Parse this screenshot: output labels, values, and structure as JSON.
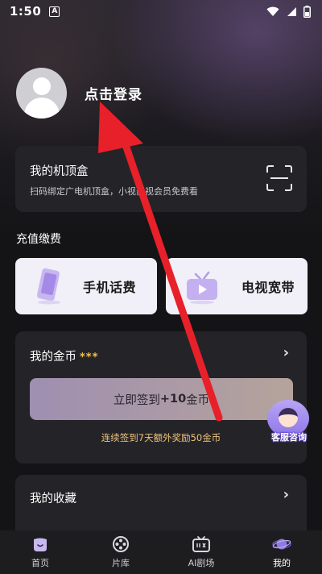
{
  "status_bar": {
    "time": "1:50",
    "notification_letter": "A"
  },
  "profile": {
    "login_text": "点击登录"
  },
  "set_top_box": {
    "title": "我的机顶盒",
    "subtitle": "扫码绑定广电机顶盒，小视影视会员免费看"
  },
  "recharge": {
    "section_title": "充值缴费",
    "phone_label": "手机话费",
    "tv_label": "电视宽带"
  },
  "coins": {
    "title": "我的金币",
    "stars": "***",
    "signin_prefix": "立即签到",
    "signin_bonus": "+10",
    "signin_suffix": "金币",
    "note": "连续签到7天额外奖励50金币"
  },
  "favorites": {
    "title": "我的收藏"
  },
  "customer_service": {
    "label": "客服咨询"
  },
  "tabbar": {
    "items": [
      {
        "label": "首页",
        "icon": "home-icon"
      },
      {
        "label": "片库",
        "icon": "film-reel-icon"
      },
      {
        "label": "AI剧场",
        "icon": "tv-icon"
      },
      {
        "label": "我的",
        "icon": "profile-planet-icon"
      }
    ],
    "active_index": 3
  },
  "colors": {
    "background": "#141416",
    "card": "#242428",
    "accent_gold": "#f3c24c",
    "note_orange": "#f0c27a",
    "arrow_red": "#e8202a"
  }
}
